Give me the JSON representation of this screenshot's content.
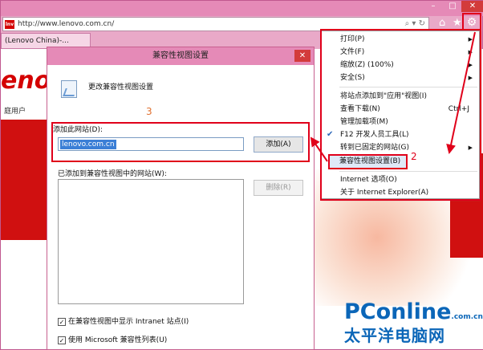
{
  "browser": {
    "address_url": "http://www.lenovo.com.cn/",
    "favicon_text": "lnv",
    "tab_label": "(Lenovo China)-...",
    "window_controls": [
      "minimize",
      "maximize",
      "close"
    ]
  },
  "page": {
    "logo_text": "enovo",
    "user_link": "庭用户",
    "brand_name": "PConline",
    "brand_suffix": ".com.cn",
    "brand_cn": "太平洋电脑网"
  },
  "dialog": {
    "title": "兼容性视图设置",
    "heading": "更改兼容性视图设置",
    "add_label": "添加此网站(D):",
    "add_value": "lenovo.com.cn",
    "add_button": "添加(A)",
    "list_label": "已添加到兼容性视图中的网站(W):",
    "remove_button": "删除(R)",
    "checkbox1": "在兼容性视图中显示 Intranet 站点(I)",
    "checkbox2": "使用 Microsoft 兼容性列表(U)",
    "checkbox1_checked": true,
    "checkbox2_checked": true
  },
  "annotations": {
    "step2": "2",
    "step3": "3"
  },
  "menu": {
    "items": [
      {
        "label": "打印(P)",
        "submenu": true
      },
      {
        "label": "文件(F)",
        "submenu": true
      },
      {
        "label": "缩放(Z) (100%)",
        "submenu": true
      },
      {
        "label": "安全(S)",
        "submenu": true
      },
      {
        "label": "将站点添加到\"应用\"视图(I)",
        "submenu": false
      },
      {
        "label": "查看下载(N)",
        "shortcut": "Ctrl+J"
      },
      {
        "label": "管理加载项(M)"
      },
      {
        "label": "F12 开发人员工具(L)",
        "checked": true
      },
      {
        "label": "转到已固定的网站(G)",
        "submenu": true
      },
      {
        "label": "兼容性视图设置(B)",
        "highlighted": true
      },
      {
        "label": "Internet 选项(O)"
      },
      {
        "label": "关于 Internet Explorer(A)"
      }
    ]
  },
  "colors": {
    "accent_red": "#e0001a",
    "chrome_pink": "#e58ab7",
    "brand_blue": "#0b66b8",
    "selection_blue": "#3b7fd6"
  }
}
